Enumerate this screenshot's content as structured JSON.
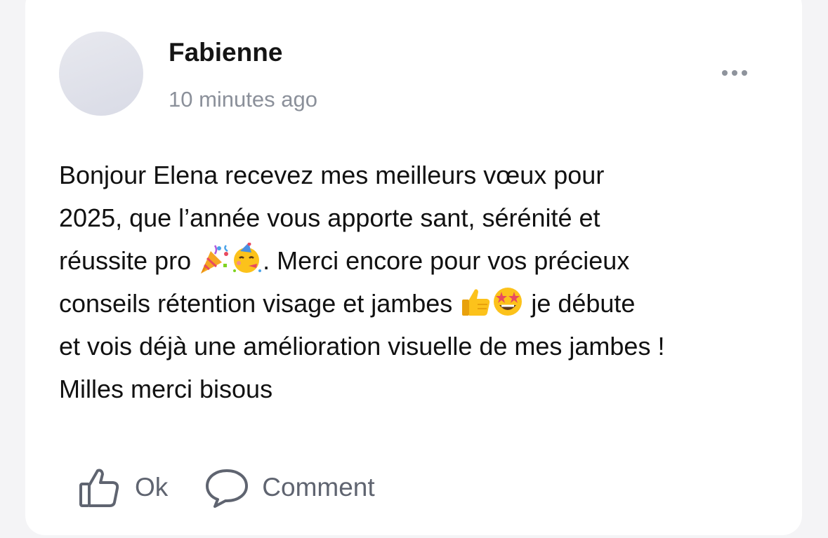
{
  "post": {
    "author": "Fabienne",
    "timestamp": "10 minutes ago",
    "body_lines": [
      "Bonjour Elena recevez mes meilleurs vœux pour",
      "2025, que l’année vous apporte sant, sérénité et",
      {
        "before": "réussite pro ",
        "after": ". Merci encore pour vos précieux"
      },
      {
        "before": "conseils rétention visage et jambes ",
        "after": " je débute"
      },
      "et vois déjà une amélioration visuelle de mes jambes !",
      "Milles merci bisous"
    ]
  },
  "actions": {
    "like_label": "Ok",
    "comment_label": "Comment"
  },
  "icons": {
    "more": "more-horizontal-icon",
    "like": "thumbs-up-icon",
    "comment": "comment-bubble-icon",
    "emoji_1": "party-popper-emoji",
    "emoji_2": "partying-face-emoji",
    "emoji_3": "thumbs-up-emoji",
    "emoji_4": "star-struck-emoji"
  },
  "colors": {
    "background": "#f4f4f6",
    "card": "#ffffff",
    "text": "#111111",
    "muted": "#8b909a",
    "action": "#5f6470"
  }
}
